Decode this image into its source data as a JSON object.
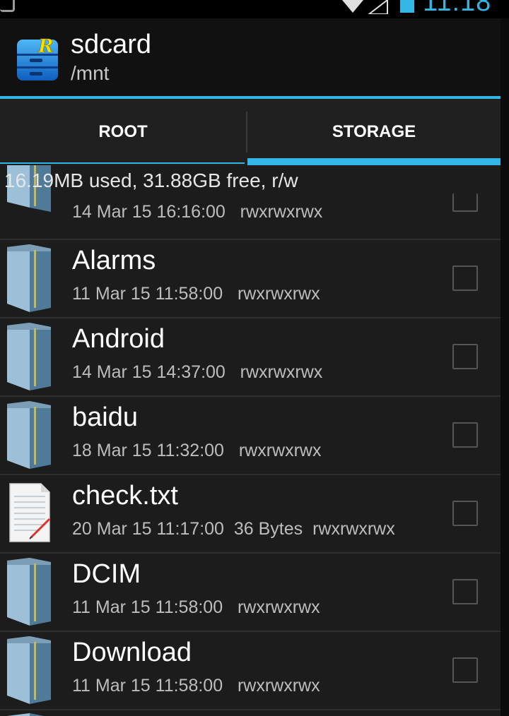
{
  "status_bar": {
    "time": "11:18",
    "icons": [
      "notification-icon",
      "wifi-icon",
      "signal-icon",
      "battery-icon"
    ],
    "accent_color": "#33b5e5"
  },
  "action_bar": {
    "title": "sdcard",
    "subtitle": "/mnt",
    "icon": "root-explorer-app-icon"
  },
  "tabs": [
    {
      "label": "ROOT",
      "selected": false
    },
    {
      "label": "STORAGE",
      "selected": true
    }
  ],
  "storage_info": "16.19MB used, 31.88GB free, r/w",
  "files": [
    {
      "name": "",
      "type": "folder",
      "date": "14 Mar 15 16:16:00",
      "size": "",
      "perms": "rwxrwxrwx"
    },
    {
      "name": "Alarms",
      "type": "folder",
      "date": "11 Mar 15 11:58:00",
      "size": "",
      "perms": "rwxrwxrwx"
    },
    {
      "name": "Android",
      "type": "folder",
      "date": "14 Mar 15 14:37:00",
      "size": "",
      "perms": "rwxrwxrwx"
    },
    {
      "name": "baidu",
      "type": "folder",
      "date": "18 Mar 15 11:32:00",
      "size": "",
      "perms": "rwxrwxrwx"
    },
    {
      "name": "check.txt",
      "type": "text-file",
      "date": "20 Mar 15 11:17:00",
      "size": "36 Bytes",
      "perms": "rwxrwxrwx"
    },
    {
      "name": "DCIM",
      "type": "folder",
      "date": "11 Mar 15 11:58:00",
      "size": "",
      "perms": "rwxrwxrwx"
    },
    {
      "name": "Download",
      "type": "folder",
      "date": "11 Mar 15 11:58:00",
      "size": "",
      "perms": "rwxrwxrwx"
    }
  ]
}
